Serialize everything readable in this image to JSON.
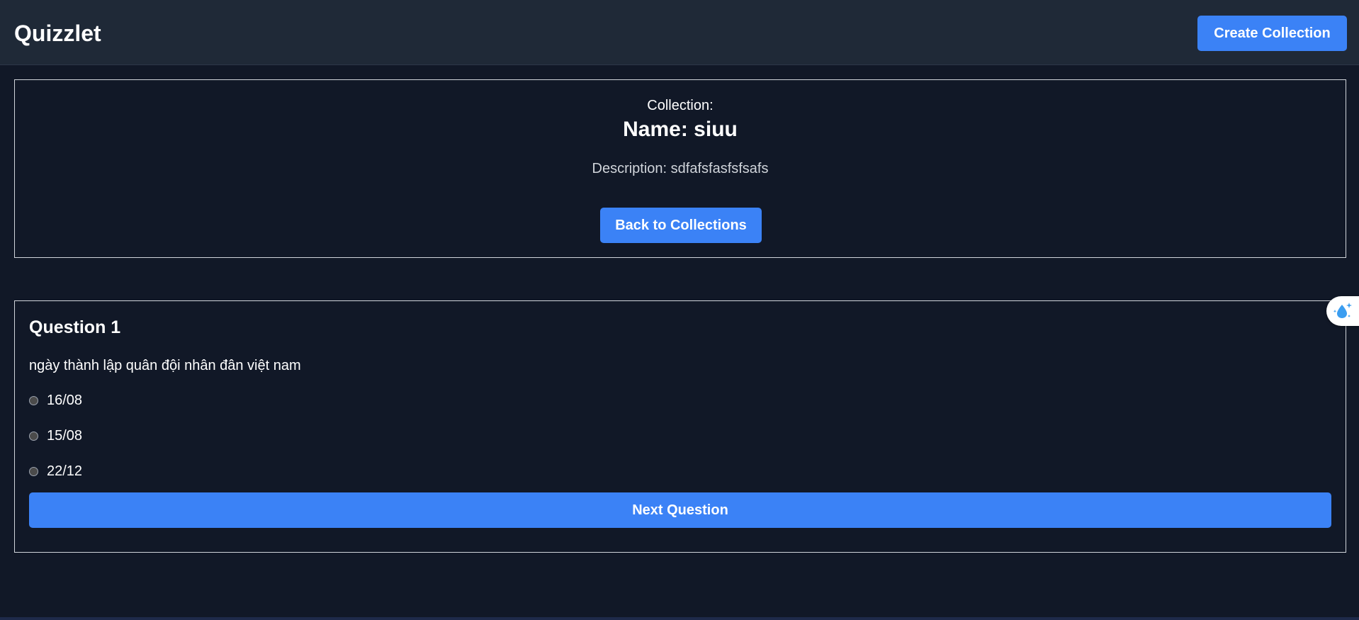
{
  "app": {
    "brand": "Quizzlet",
    "create_button": "Create Collection"
  },
  "collection": {
    "label": "Collection:",
    "name": "Name: siuu",
    "description": "Description: sdfafsfasfsfsafs",
    "back_button": "Back to Collections"
  },
  "question": {
    "title": "Question 1",
    "text": "ngày thành lập quân đội nhân đân việt nam",
    "options": [
      {
        "label": "16/08",
        "selected": false
      },
      {
        "label": "15/08",
        "selected": false
      },
      {
        "label": "22/12",
        "selected": false
      }
    ],
    "next_button": "Next Question"
  },
  "extension_widget": {
    "icon": "water-drop-sparkle-icon",
    "accent": "#3b9df0"
  },
  "colors": {
    "background": "#111827",
    "header": "#1f2937",
    "accent": "#3b82f6"
  }
}
